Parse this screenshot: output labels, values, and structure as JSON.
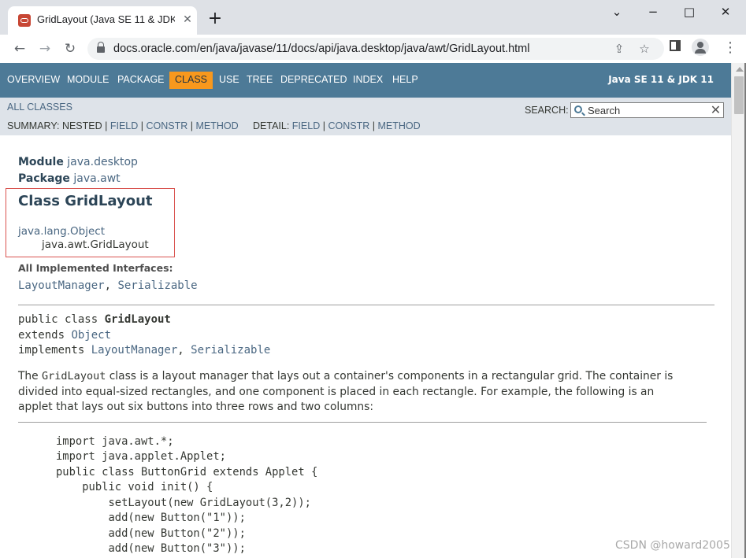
{
  "browser": {
    "tab_title": "GridLayout (Java SE 11 & JDK",
    "tab_close": "✕",
    "new_tab": "+",
    "url": "docs.oracle.com/en/java/javase/11/docs/api/java.desktop/java/awt/GridLayout.html",
    "window_controls": {
      "minimize": "−",
      "maximize": "□",
      "close": "✕",
      "chevron": "⌄"
    },
    "nav": {
      "back": "←",
      "forward": "→",
      "reload": "↻"
    },
    "omnibox_icons": {
      "share": "⇪",
      "bookmark": "☆"
    },
    "menu": "⋮"
  },
  "topnav": {
    "items": [
      "OVERVIEW",
      "MODULE",
      "PACKAGE",
      "CLASS",
      "USE",
      "TREE",
      "DEPRECATED",
      "INDEX",
      "HELP"
    ],
    "active_item": "CLASS",
    "active_color": "#f8981d",
    "bar_color": "#4d7a97",
    "version": "Java SE 11 & JDK 11"
  },
  "subnav": {
    "all_classes": "ALL CLASSES",
    "summary_label": "SUMMARY:",
    "summary_items": [
      "NESTED",
      "FIELD",
      "CONSTR",
      "METHOD"
    ],
    "detail_label": "DETAIL:",
    "detail_items": [
      "FIELD",
      "CONSTR",
      "METHOD"
    ],
    "separator": "|",
    "search_label": "SEARCH:",
    "search_placeholder": "Search",
    "search_reset": "✕"
  },
  "header": {
    "module_label": "Module",
    "module_value": "java.desktop",
    "package_label": "Package",
    "package_value": "java.awt",
    "class_title": "Class GridLayout",
    "inheritance": [
      "java.lang.Object",
      "java.awt.GridLayout"
    ]
  },
  "implemented": {
    "heading": "All Implemented Interfaces:",
    "items": [
      "LayoutManager",
      "Serializable"
    ],
    "separator": ", "
  },
  "declaration": {
    "line1_prefix": "public class ",
    "line1_name": "GridLayout",
    "line2_prefix": "extends ",
    "line2_link": "Object",
    "line3_prefix": "implements ",
    "line3_link1": "LayoutManager",
    "line3_sep": ", ",
    "line3_link2": "Serializable"
  },
  "description": {
    "lead": "The ",
    "code": "GridLayout",
    "line1_rest": " class is a layout manager that lays out a container's components in a rectangular grid. The container is",
    "line2": "divided into equal-sized rectangles, and one component is placed in each rectangle. For example, the following is an",
    "line3": "applet that lays out six buttons into three rows and two columns:"
  },
  "code_example": [
    "import java.awt.*;",
    "import java.applet.Applet;",
    "public class ButtonGrid extends Applet {",
    "    public void init() {",
    "        setLayout(new GridLayout(3,2));",
    "        add(new Button(\"1\"));",
    "        add(new Button(\"2\"));",
    "        add(new Button(\"3\"));"
  ],
  "watermark": "CSDN @howard2005"
}
